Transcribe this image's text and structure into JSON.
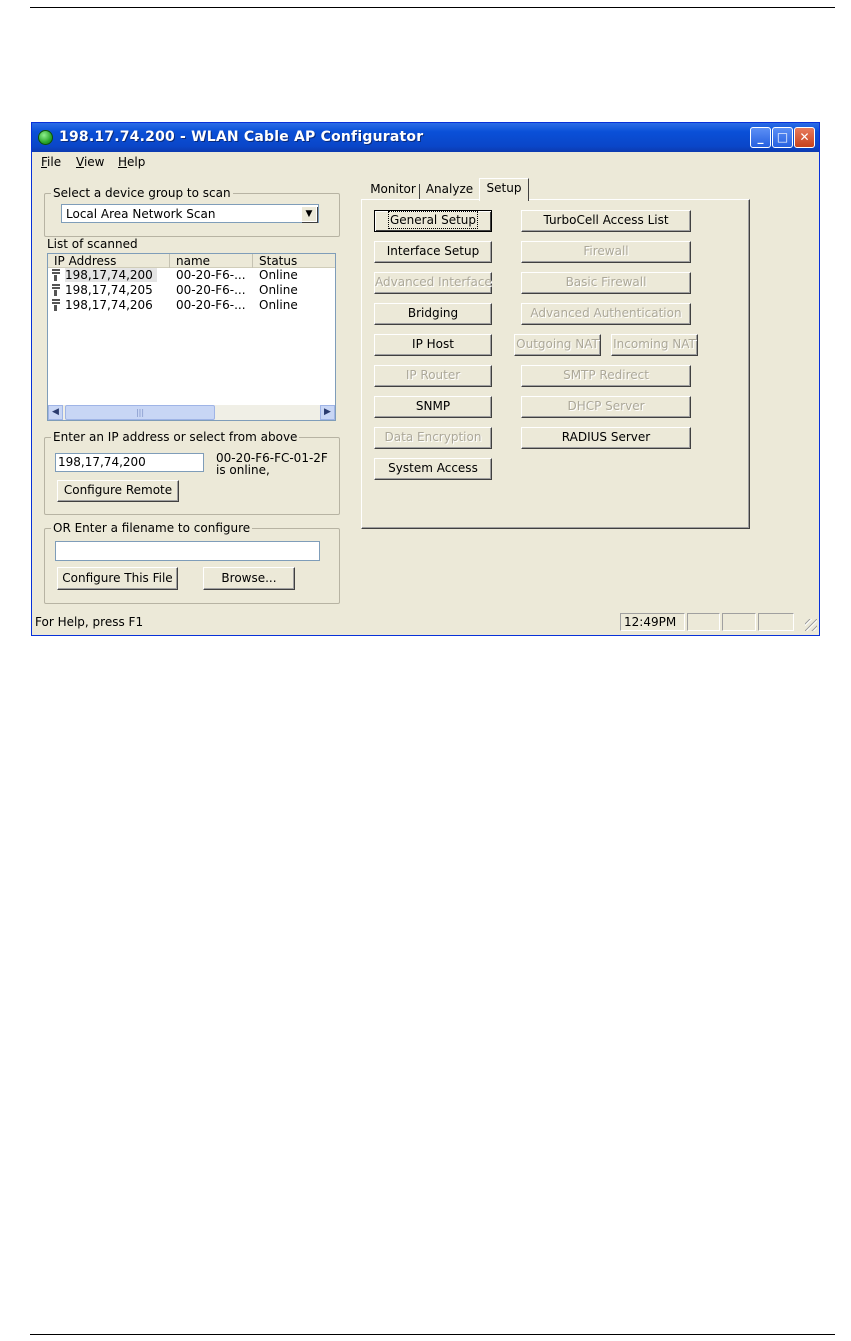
{
  "window": {
    "title": "198.17.74.200 - WLAN Cable AP Configurator",
    "controls": {
      "minimize": "_",
      "maximize": "□",
      "close": "✕"
    }
  },
  "menu": [
    {
      "pre": "",
      "accel": "F",
      "post": "ile"
    },
    {
      "pre": "",
      "accel": "V",
      "post": "iew"
    },
    {
      "pre": "",
      "accel": "H",
      "post": "elp"
    }
  ],
  "scan_group": {
    "legend": "Select a device group to scan",
    "selected": "Local Area Network Scan"
  },
  "list": {
    "label": "List of scanned",
    "columns": [
      "IP Address",
      "name",
      "Status"
    ],
    "rows": [
      {
        "ip": "198,17,74,200",
        "name": "00-20-F6-...",
        "status": "Online"
      },
      {
        "ip": "198,17,74,205",
        "name": "00-20-F6-...",
        "status": "Online"
      },
      {
        "ip": "198,17,74,206",
        "name": "00-20-F6-...",
        "status": "Online"
      }
    ]
  },
  "ip_group": {
    "legend": "Enter an IP address or select from above",
    "ip_value": "198,17,74,200",
    "device_id": "00-20-F6-FC-01-2F",
    "device_status": "is online,",
    "configure_remote": "Configure Remote"
  },
  "file_group": {
    "legend": "OR Enter a filename to configure",
    "filename_value": "",
    "configure_file": "Configure This File",
    "browse": "Browse..."
  },
  "tabs": [
    "Monitor",
    "Analyze",
    "Setup"
  ],
  "active_tab": "Setup",
  "setup_buttons": {
    "general_setup": "General Setup",
    "interface_setup": "Interface Setup",
    "advanced_interface": "Advanced Interface",
    "bridging": "Bridging",
    "ip_host": "IP Host",
    "ip_router": "IP Router",
    "snmp": "SNMP",
    "data_encryption": "Data Encryption",
    "system_access": "System Access",
    "turbocell_access_list": "TurboCell Access List",
    "firewall": "Firewall",
    "basic_firewall": "Basic Firewall",
    "advanced_authentication": "Advanced Authentication",
    "outgoing_nat": "Outgoing NAT",
    "incoming_nat": "Incoming NAT",
    "smtp_redirect": "SMTP Redirect",
    "dhcp_server": "DHCP Server",
    "radius_server": "RADIUS Server"
  },
  "status": {
    "help_text": "For Help, press F1",
    "time": "12:49PM"
  }
}
